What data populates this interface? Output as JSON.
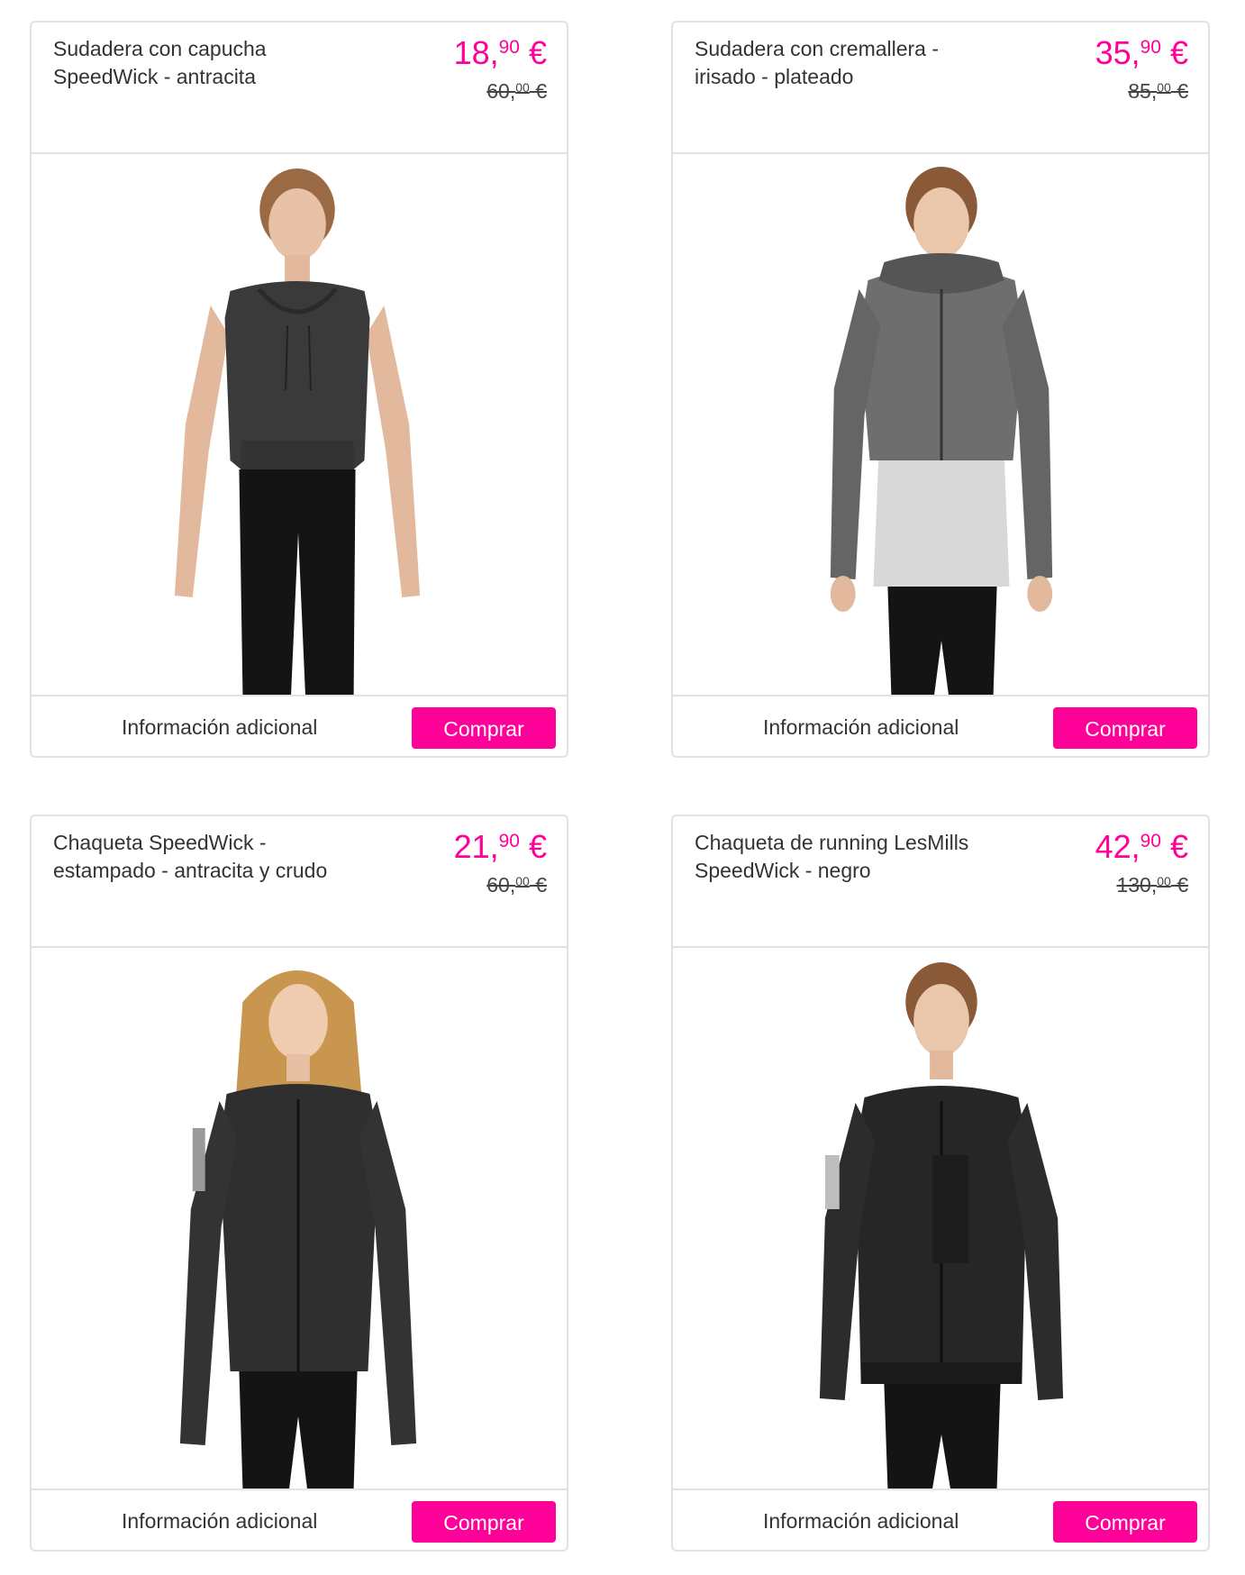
{
  "products": [
    {
      "title_line1": "Sudadera con capucha",
      "title_line2": "SpeedWick - antracita",
      "price_int": "18,",
      "price_cents": "90",
      "price_currency": " €",
      "old_int": "60,",
      "old_cents": "00",
      "old_currency": " €",
      "info_label": "Información adicional",
      "buy_label": "Comprar",
      "garment_color": "#3a3a3a"
    },
    {
      "title_line1": "Sudadera con cremallera -",
      "title_line2": "irisado - plateado",
      "price_int": "35,",
      "price_cents": "90",
      "price_currency": " €",
      "old_int": "85,",
      "old_cents": "00",
      "old_currency": " €",
      "info_label": "Información adicional",
      "buy_label": "Comprar",
      "garment_color": "#6e6e6e"
    },
    {
      "title_line1": "Chaqueta SpeedWick -",
      "title_line2": "estampado - antracita y crudo",
      "price_int": "21,",
      "price_cents": "90",
      "price_currency": " €",
      "old_int": "60,",
      "old_cents": "00",
      "old_currency": " €",
      "info_label": "Información adicional",
      "buy_label": "Comprar",
      "garment_color": "#2f2f2f"
    },
    {
      "title_line1": "Chaqueta de running LesMills",
      "title_line2": "SpeedWick - negro",
      "price_int": "42,",
      "price_cents": "90",
      "price_currency": " €",
      "old_int": "130,",
      "old_cents": "00",
      "old_currency": " €",
      "info_label": "Información adicional",
      "buy_label": "Comprar",
      "garment_color": "#262626"
    }
  ],
  "colors": {
    "accent": "#ff0099",
    "border": "#e2e2e2"
  }
}
